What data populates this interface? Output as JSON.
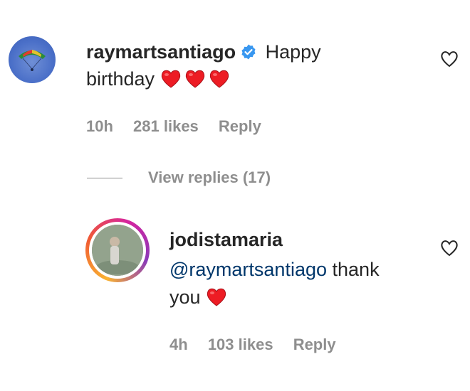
{
  "comment": {
    "username": "raymartsantiago",
    "text_part1": "Happy",
    "text_part2": "birthday",
    "time": "10h",
    "likes": "281 likes",
    "reply": "Reply",
    "view_replies": "View replies (17)"
  },
  "reply_comment": {
    "username": "jodistamaria",
    "mention": "@raymartsantiago",
    "text_part1": "thank",
    "text_part2": "you",
    "time": "4h",
    "likes": "103 likes",
    "reply": "Reply"
  },
  "colors": {
    "heart_red": "#ed1c24",
    "verified_blue": "#3897f0",
    "meta_gray": "#8e8e8e",
    "mention_blue": "#00376b"
  },
  "icons": {
    "verified": "verified-badge-icon",
    "like": "heart-outline-icon",
    "emoji_heart": "red-heart-emoji"
  }
}
